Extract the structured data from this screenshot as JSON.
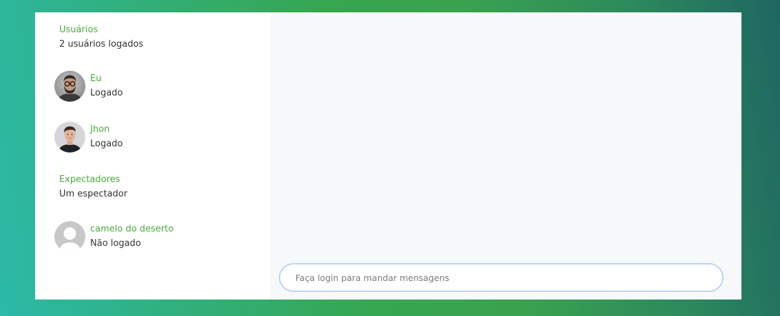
{
  "users_section": {
    "title": "Usuários",
    "subtitle": "2 usuários logados"
  },
  "users": [
    {
      "name": "Eu",
      "status": "Logado",
      "avatar_icon": "bearded-man-glasses-avatar"
    },
    {
      "name": "Jhon",
      "status": "Logado",
      "avatar_icon": "young-man-avatar"
    }
  ],
  "spectators_section": {
    "title": "Expectadores",
    "subtitle": "Um espectador"
  },
  "spectators": [
    {
      "name": "camelo do deserto",
      "status": "Não logado",
      "avatar_icon": "default-user-avatar"
    }
  ],
  "chat": {
    "input_value": "",
    "input_placeholder": "Faça login para mandar mensagens"
  },
  "colors": {
    "accent": "#4aaa3c",
    "input_border": "#bcd4f0",
    "chat_background": "#f7f8fa"
  }
}
